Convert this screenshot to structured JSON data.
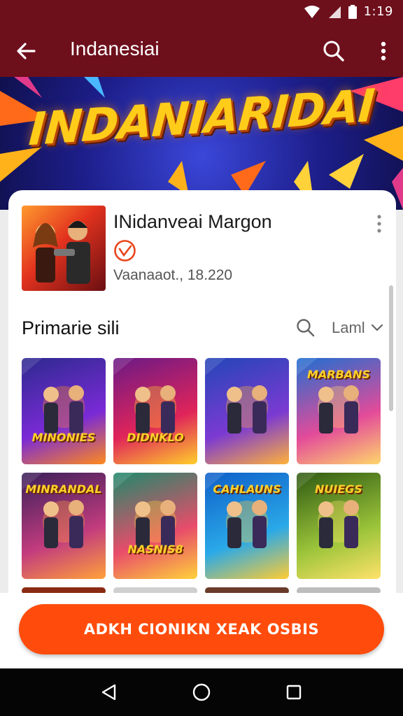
{
  "status_bar": {
    "time": "1:19"
  },
  "app_bar": {
    "title": "Indanesiai"
  },
  "banner": {
    "title": "INDANIARIDAI"
  },
  "app": {
    "name": "INidanveai Margon",
    "meta": "Vaanaaot., 18.220"
  },
  "section": {
    "title": "Primarie sili",
    "filter_label": "Laml"
  },
  "tiles": [
    {
      "label": "MINONIES",
      "colors": [
        "#2d2a8f",
        "#7a2ad6",
        "#ff8a1d"
      ]
    },
    {
      "label": "DIDNKLO",
      "colors": [
        "#6b1a86",
        "#e0245a",
        "#ffcf2b"
      ]
    },
    {
      "label": "",
      "colors": [
        "#2346b8",
        "#7b3ad2",
        "#ffb23a"
      ]
    },
    {
      "label": "MARBANS",
      "colors": [
        "#1e6fd1",
        "#e34b9a",
        "#ffd66b"
      ]
    },
    {
      "label": "MINRANDAL",
      "colors": [
        "#3a1f5a",
        "#c23c7e",
        "#ffa13a"
      ]
    },
    {
      "label": "NASNIS8",
      "colors": [
        "#1e8a6b",
        "#e84c6a",
        "#ffd23a"
      ]
    },
    {
      "label": "CAHLAUNS",
      "colors": [
        "#0f5fc9",
        "#2aa9e8",
        "#ffcc33"
      ]
    },
    {
      "label": "NUIEGS",
      "colors": [
        "#2f5a12",
        "#9bc43a",
        "#ffe26a"
      ]
    }
  ],
  "cta": {
    "label": "ADKH CIONIKN XEAK OSBIS"
  },
  "colors": {
    "app_bar": "#6e0f1c",
    "accent": "#ff4c0c"
  },
  "icons": [
    "back-arrow-icon",
    "search-icon",
    "more-vert-icon",
    "wifi-icon",
    "signal-icon",
    "battery-icon",
    "check-badge-icon",
    "chevron-down-icon",
    "nav-back-icon",
    "nav-home-icon",
    "nav-recents-icon"
  ]
}
